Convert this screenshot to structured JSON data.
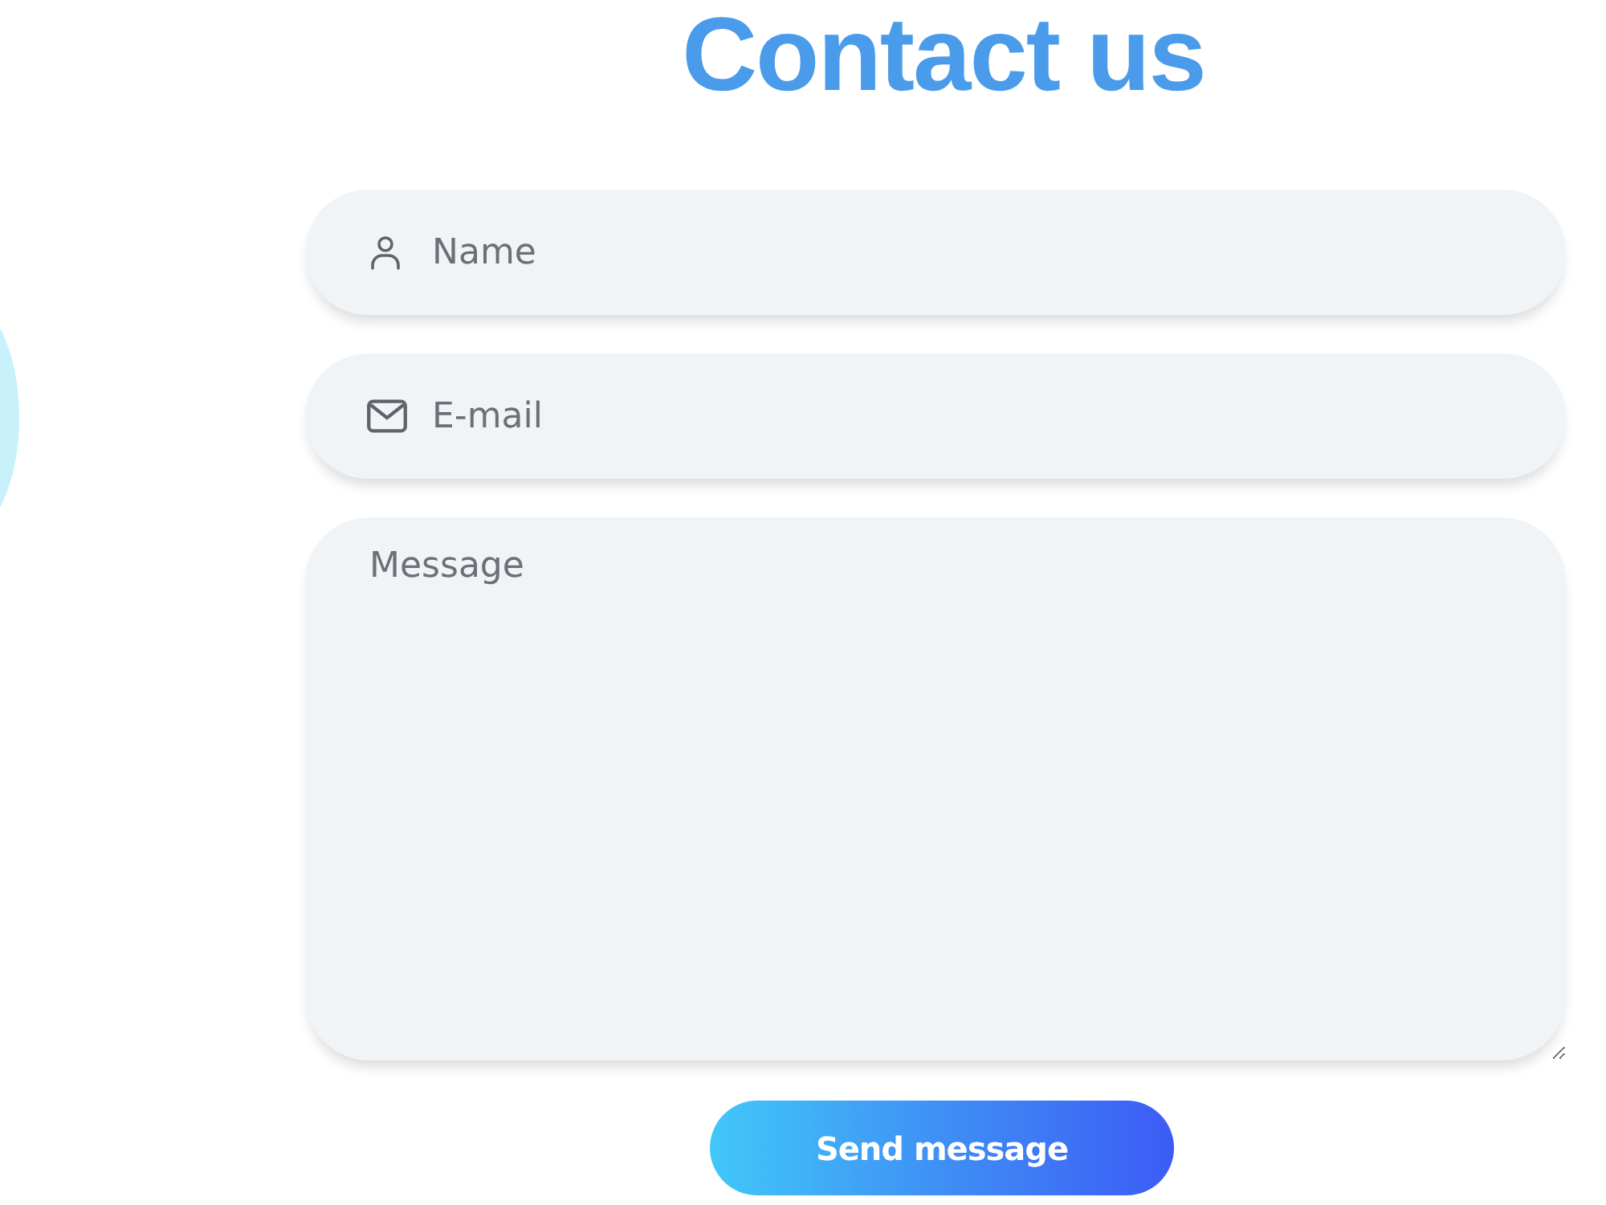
{
  "heading": {
    "title": "Contact us"
  },
  "form": {
    "fields": [
      {
        "kind": "text",
        "placeholder": "Name"
      },
      {
        "kind": "email",
        "placeholder": "E-mail"
      },
      {
        "kind": "textarea",
        "placeholder": "Message"
      }
    ],
    "submit": {
      "label": "Send message"
    }
  }
}
